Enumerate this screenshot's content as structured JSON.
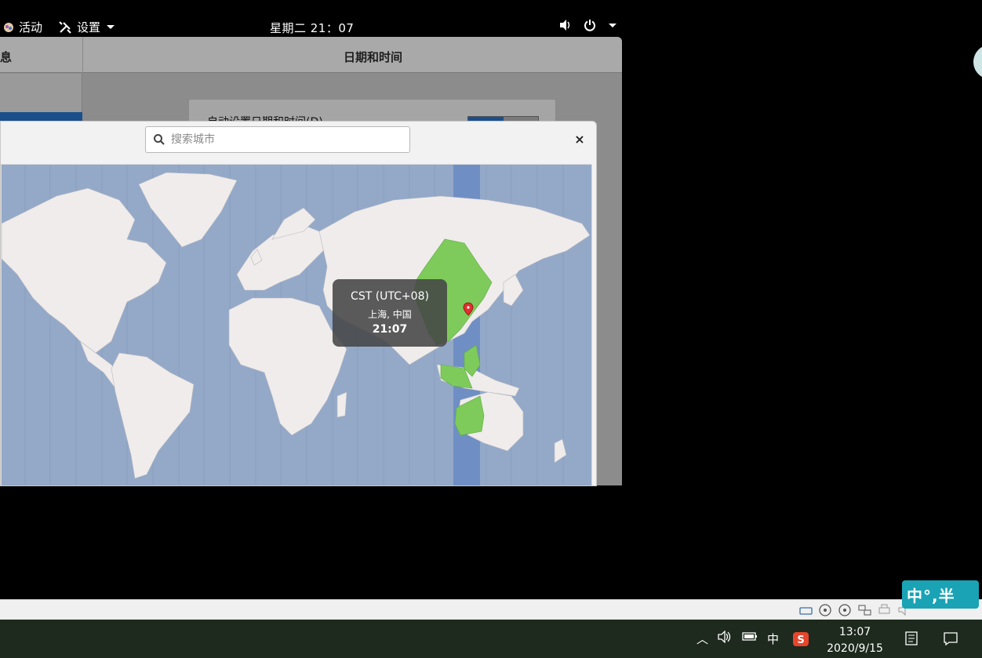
{
  "topbar": {
    "activities": "活动",
    "app_menu": "设置",
    "clock": "星期二 21：07"
  },
  "settings": {
    "sidebar_header": "息",
    "title": "日期和时间",
    "auto_datetime_label": "自动设置日期和时间(D)"
  },
  "timezone_dialog": {
    "search_placeholder": "搜索城市",
    "close_label": "×",
    "tooltip": {
      "timezone": "CST (UTC+08)",
      "city": "上海, 中国",
      "time": "21:07"
    }
  },
  "ime": {
    "label": "中°,半"
  },
  "taskbar": {
    "input_method": "中",
    "time": "13:07",
    "date": "2020/9/15"
  },
  "colors": {
    "ocean": "#94a9c8",
    "land": "#efeceb",
    "highlight_zone": "#7ecb5b",
    "selected_band": "#6f8fc4"
  }
}
